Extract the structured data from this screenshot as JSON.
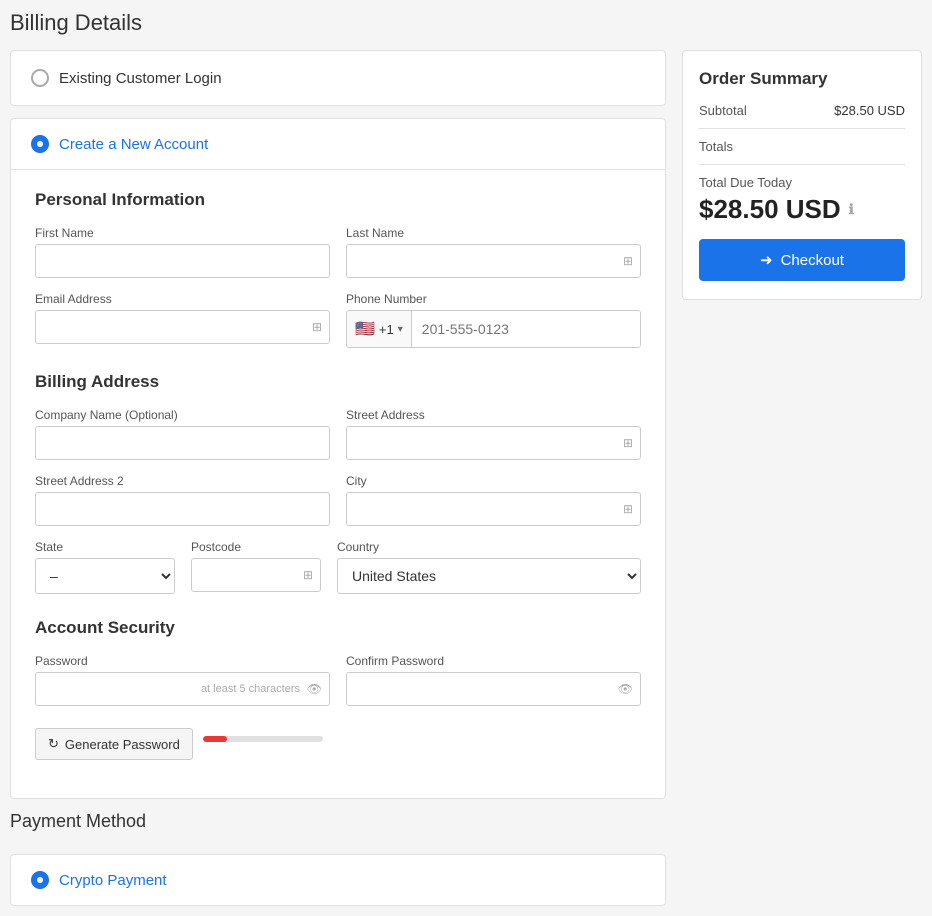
{
  "page": {
    "title": "Billing Details"
  },
  "login_section": {
    "label": "Existing Customer Login"
  },
  "new_account": {
    "label": "Create a New Account",
    "personal_info": {
      "title": "Personal Information",
      "first_name_label": "First Name",
      "last_name_label": "Last Name",
      "email_label": "Email Address",
      "phone_label": "Phone Number",
      "phone_placeholder": "201-555-0123",
      "phone_flag": "🇺🇸",
      "phone_code": "+1"
    },
    "billing_address": {
      "title": "Billing Address",
      "company_label": "Company Name (Optional)",
      "street_label": "Street Address",
      "street2_label": "Street Address 2",
      "city_label": "City",
      "state_label": "State",
      "state_default": "–",
      "postcode_label": "Postcode",
      "country_label": "Country",
      "country_value": "United States"
    },
    "account_security": {
      "title": "Account Security",
      "password_label": "Password",
      "password_hint": "at least 5 characters",
      "confirm_label": "Confirm Password",
      "generate_btn": "Generate Password"
    }
  },
  "payment": {
    "title": "Payment Method",
    "option_label": "Crypto Payment"
  },
  "order_summary": {
    "title": "Order Summary",
    "subtotal_label": "Subtotal",
    "subtotal_value": "$28.50 USD",
    "totals_label": "Totals",
    "total_due_label": "Total Due Today",
    "total_amount": "$28.50 USD",
    "checkout_label": "Checkout"
  }
}
